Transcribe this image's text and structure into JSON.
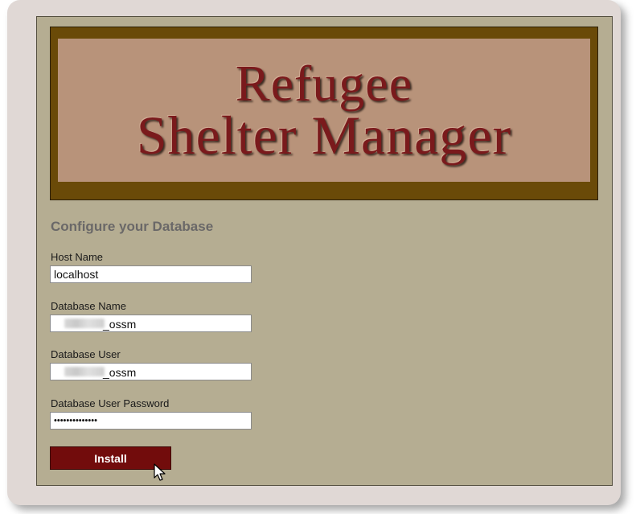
{
  "banner": {
    "title_line1": "Refugee",
    "title_line2": "Shelter Manager"
  },
  "form": {
    "heading": "Configure your Database",
    "host_name": {
      "label": "Host Name",
      "value": "localhost"
    },
    "database_name": {
      "label": "Database Name",
      "value_suffix": "_ossm"
    },
    "database_user": {
      "label": "Database User",
      "value_suffix": "_ossm"
    },
    "database_password": {
      "label": "Database User Password",
      "value": "••••••••••••••"
    },
    "install_label": "Install"
  },
  "colors": {
    "panel": "#b5ad92",
    "banner_frame": "#6a4a08",
    "banner_inner": "#b8937a",
    "title_text": "#7a1a1c",
    "button": "#720c0c"
  }
}
